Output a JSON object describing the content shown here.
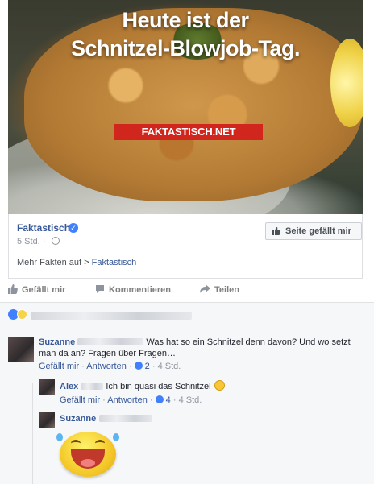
{
  "post": {
    "image_title_line1": "Heute ist der",
    "image_title_line2": "Schnitzel-Blowjob-Tag.",
    "image_brand": "FAKTASTISCH.NET",
    "page_name": "Faktastisch",
    "time": "5 Std.",
    "meta_sep": "·",
    "like_page_label": "Seite gefällt mir",
    "more_facts_prefix": "Mehr Fakten auf > ",
    "more_facts_link": "Faktastisch"
  },
  "actions": {
    "like": "Gefällt mir",
    "comment": "Kommentieren",
    "share": "Teilen"
  },
  "comments": [
    {
      "author": "Suzanne",
      "text_line1": "Was hat so ein Schnitzel denn davon? Und wo setzt",
      "text_line2": "man da an? Fragen über Fragen…",
      "like_link": "Gefällt mir",
      "reply_link": "Antworten",
      "likes": "2",
      "time": "4 Std."
    },
    {
      "author": "Alex",
      "text": "Ich bin quasi das Schnitzel",
      "like_link": "Gefällt mir",
      "reply_link": "Antworten",
      "likes": "4",
      "time": "4 Std."
    },
    {
      "author": "Suzanne"
    }
  ],
  "colors": {
    "link": "#365899",
    "brand_red": "#d0261d",
    "like_blue": "#4080ff"
  },
  "icons": [
    "verified-icon",
    "globe-icon",
    "thumbs-up-icon",
    "comment-icon",
    "share-icon",
    "like-reaction-icon",
    "haha-reaction-icon",
    "laughing-emoji"
  ]
}
